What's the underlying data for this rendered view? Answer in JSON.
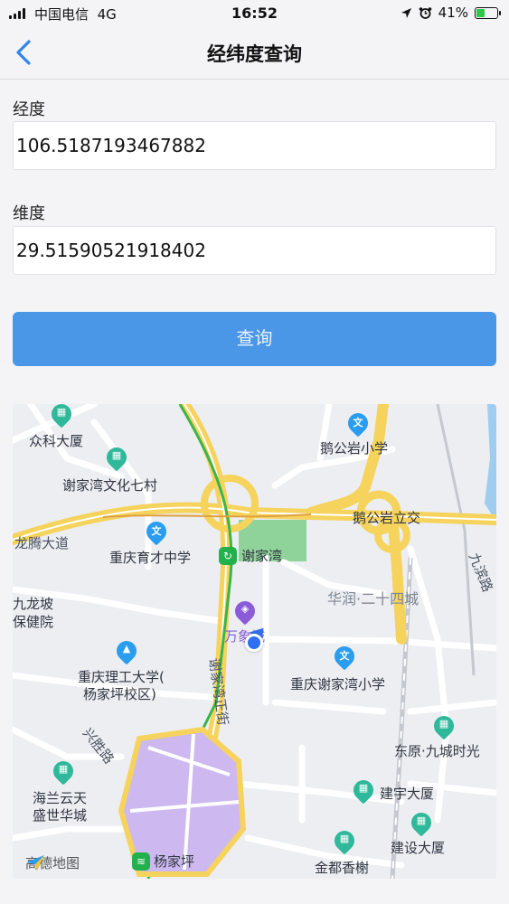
{
  "status_bar": {
    "carrier": "中国电信",
    "network": "4G",
    "time": "16:52",
    "battery": "41%",
    "battery_level": 0.41
  },
  "nav": {
    "title": "经纬度查询"
  },
  "form": {
    "longitude_label": "经度",
    "longitude_value": "106.5187193467882",
    "latitude_label": "维度",
    "latitude_value": "29.51590521918402",
    "submit_label": "查询"
  },
  "map": {
    "brand": "高德地图",
    "places": {
      "zhongke": "众科大厦",
      "xiejiawan_village": "谢家湾文化七村",
      "longteng": "龙腾大道",
      "yucai": "重庆育才中学",
      "xiejiawan_station": "谢家湾",
      "wanxiangcheng": "万象城",
      "huarun": "华润·二十四城",
      "ehongyan_school": "鹅公岩小学",
      "ehongyan_interchange": "鹅公岩立交",
      "jiubin": "九滨路",
      "jiulongpo_1": "九龙坡",
      "jiulongpo_2": "保健院",
      "ligong_1": "重庆理工大学(",
      "ligong_2": "杨家坪校区)",
      "xiejiawan_st": "谢家湾正街",
      "xiejiawan_primary": "重庆谢家湾小学",
      "xingsheng": "兴胜路",
      "dongyuan": "东原·九城时光",
      "haitian_1": "海兰云天",
      "haitian_2": "盛世华城",
      "jianyu": "建宇大厦",
      "jianshe": "建设大厦",
      "jindu": "金都香榭",
      "yangjiaping": "杨家坪"
    }
  }
}
